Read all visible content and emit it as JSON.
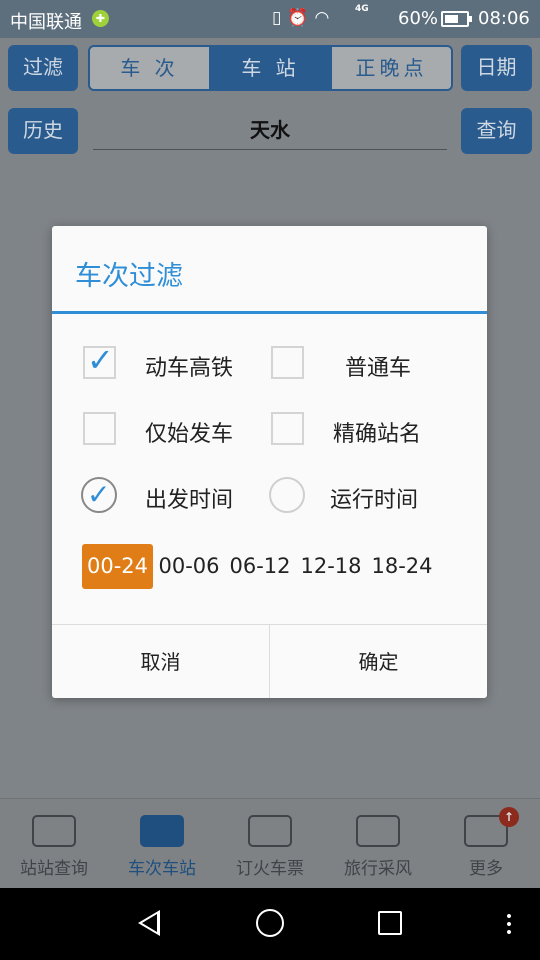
{
  "status_bar": {
    "carrier": "中国联通",
    "battery": "60%",
    "time": "08:06",
    "network": "4G"
  },
  "header": {
    "filter_button": "过滤",
    "tabs": [
      {
        "label": "车 次",
        "active": false
      },
      {
        "label": "车 站",
        "active": true
      },
      {
        "label": "正晚点",
        "active": false
      }
    ],
    "date_button": "日期",
    "history_button": "历史",
    "station_value": "天水",
    "query_button": "查询"
  },
  "dialog": {
    "title": "车次过滤",
    "options": [
      {
        "label": "动车高铁",
        "checked": true
      },
      {
        "label": "普通车",
        "checked": false
      },
      {
        "label": "仅始发车",
        "checked": false
      },
      {
        "label": "精确站名",
        "checked": false
      }
    ],
    "time_modes": [
      {
        "label": "出发时间",
        "selected": true
      },
      {
        "label": "运行时间",
        "selected": false
      }
    ],
    "time_ranges": [
      "00-24",
      "00-06",
      "06-12",
      "12-18",
      "18-24"
    ],
    "active_time_range": "00-24",
    "cancel": "取消",
    "confirm": "确定"
  },
  "bottom_nav": [
    {
      "label": "站站查询",
      "icon": "train-icon",
      "active": false
    },
    {
      "label": "车次车站",
      "icon": "briefcase-icon",
      "active": true
    },
    {
      "label": "订火车票",
      "icon": "ticket-icon",
      "active": false
    },
    {
      "label": "旅行采风",
      "icon": "chat-icon",
      "active": false
    },
    {
      "label": "更多",
      "icon": "grid-icon",
      "active": false,
      "badge": "↑"
    }
  ],
  "colors": {
    "accent": "#2f8ed6",
    "brand": "#2a5b8e",
    "selected_chip": "#e07d16"
  }
}
